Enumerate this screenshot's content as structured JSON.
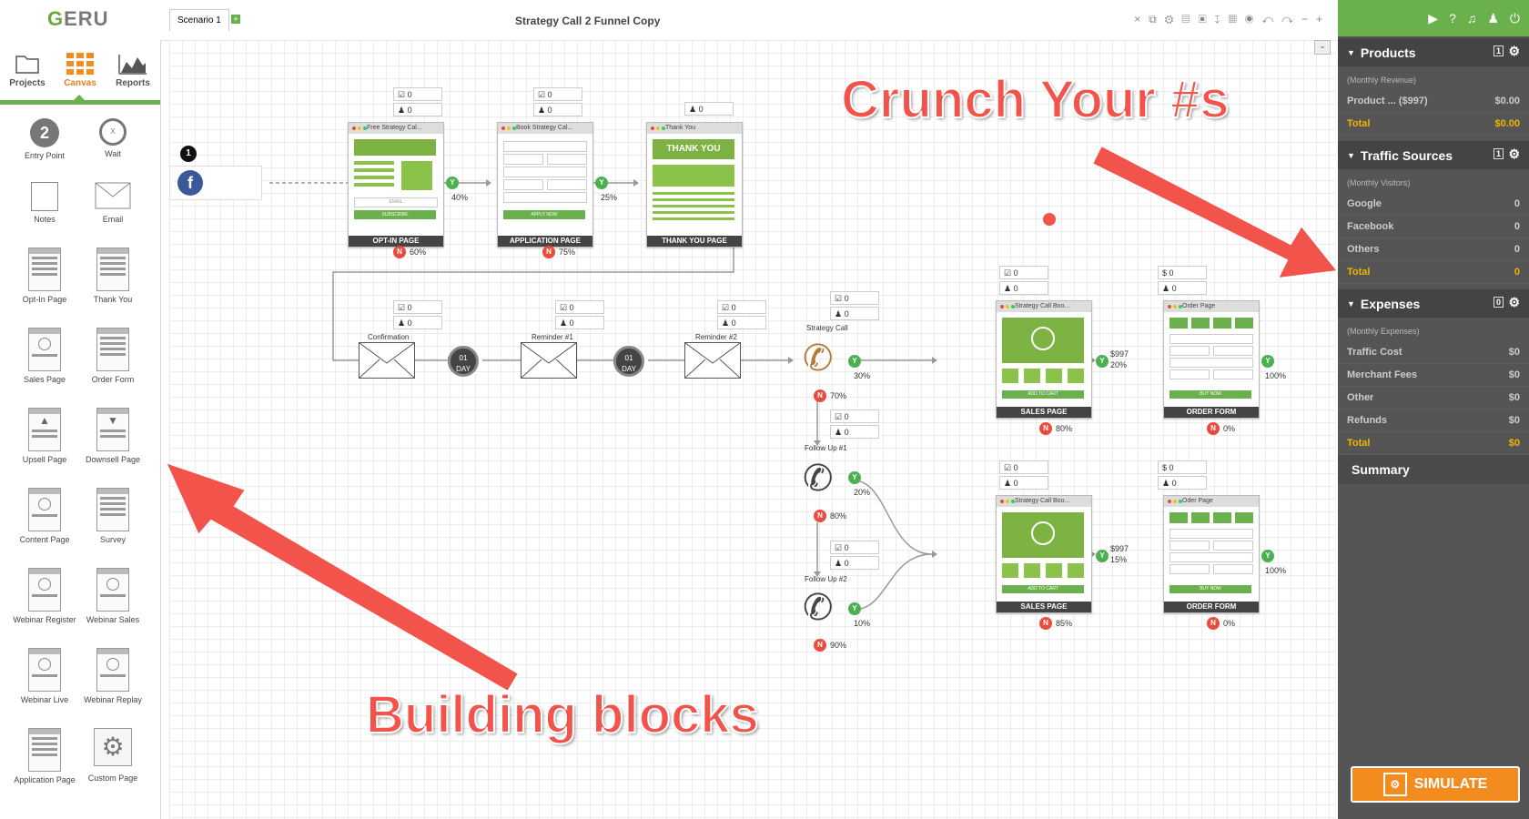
{
  "app": {
    "logo": "GERU"
  },
  "nav": {
    "tabs": [
      {
        "label": "Projects"
      },
      {
        "label": "Canvas"
      },
      {
        "label": "Reports"
      }
    ]
  },
  "blocks": [
    {
      "label": "Entry Point"
    },
    {
      "label": "Wait"
    },
    {
      "label": "Notes"
    },
    {
      "label": "Email"
    },
    {
      "label": "Opt-In Page"
    },
    {
      "label": "Thank You"
    },
    {
      "label": "Sales Page"
    },
    {
      "label": "Order Form"
    },
    {
      "label": "Upsell Page"
    },
    {
      "label": "Downsell Page"
    },
    {
      "label": "Content Page"
    },
    {
      "label": "Survey"
    },
    {
      "label": "Webinar Register"
    },
    {
      "label": "Webinar Sales"
    },
    {
      "label": "Webinar Live"
    },
    {
      "label": "Webinar Replay"
    },
    {
      "label": "Application Page"
    },
    {
      "label": "Custom Page"
    }
  ],
  "entry_point_count": "2",
  "toolbar": {
    "scenario_tab": "Scenario 1",
    "title": "Strategy Call 2 Funnel Copy"
  },
  "canvas": {
    "entry_badge": "1",
    "pages": [
      {
        "title": "Free Strategy Cal...",
        "footer": "OPT-IN PAGE",
        "button": "SUBSCRIBE",
        "input": "EMAIL",
        "yes": "40%",
        "no": "60%"
      },
      {
        "title": "Book Strategy Cal...",
        "footer": "APPLICATION PAGE",
        "button": "APPLY NOW",
        "yes": "25%",
        "no": "75%"
      },
      {
        "title": "Thank You",
        "footer": "THANK YOU PAGE",
        "headline": "THANK YOU"
      },
      {
        "title": "Strategy Call Boo...",
        "footer": "SALES PAGE",
        "button": "ADD TO CART",
        "price": "$997",
        "yes": "20%",
        "no": "80%"
      },
      {
        "title": "Order Page",
        "footer": "ORDER FORM",
        "button": "BUY NOW",
        "yes": "100%",
        "no": "0%"
      },
      {
        "title": "Strategy Call Boo...",
        "footer": "SALES PAGE",
        "button": "ADD TO CART",
        "price": "$997",
        "yes": "15%",
        "no": "85%"
      },
      {
        "title": "Oder Page",
        "footer": "ORDER FORM",
        "button": "BUY NOW",
        "yes": "100%",
        "no": "0%"
      }
    ],
    "emails": [
      {
        "label": "Confirmation"
      },
      {
        "label": "Reminder #1"
      },
      {
        "label": "Reminder #2"
      }
    ],
    "wait_text": {
      "days": "01",
      "unit": "DAY"
    },
    "calls": [
      {
        "label": "Strategy Call",
        "yes": "30%",
        "no": "70%"
      },
      {
        "label": "Follow Up #1",
        "yes": "20%",
        "no": "80%"
      },
      {
        "label": "Follow Up #2",
        "yes": "10%",
        "no": "90%"
      }
    ],
    "stat_zero": "0",
    "stat_dollar": "$",
    "yes_letter": "Y",
    "no_letter": "N"
  },
  "panel": {
    "products": {
      "title": "Products",
      "count": "1",
      "sub": "(Monthly Revenue)",
      "rows": [
        {
          "label": "Product ...  ($997)",
          "value": "$0.00"
        }
      ],
      "total_label": "Total",
      "total": "$0.00"
    },
    "traffic": {
      "title": "Traffic Sources",
      "count": "1",
      "sub": "(Monthly Visitors)",
      "rows": [
        {
          "label": "Google",
          "value": "0"
        },
        {
          "label": "Facebook",
          "value": "0"
        },
        {
          "label": "Others",
          "value": "0"
        }
      ],
      "total_label": "Total",
      "total": "0"
    },
    "expenses": {
      "title": "Expenses",
      "count": "0",
      "sub": "(Monthly Expenses)",
      "rows": [
        {
          "label": "Traffic Cost",
          "value": "$0"
        },
        {
          "label": "Merchant Fees",
          "value": "$0"
        },
        {
          "label": "Other",
          "value": "$0"
        },
        {
          "label": "Refunds",
          "value": "$0"
        }
      ],
      "total_label": "Total",
      "total": "$0"
    },
    "summary": "Summary",
    "simulate": "SIMULATE"
  },
  "annotations": {
    "top": "Crunch Your #s",
    "bottom": "Building blocks"
  },
  "colors": {
    "accent": "#6ab04c",
    "simulate": "#f28c1f",
    "annotation": "#f2544b",
    "total": "#f0b400"
  }
}
